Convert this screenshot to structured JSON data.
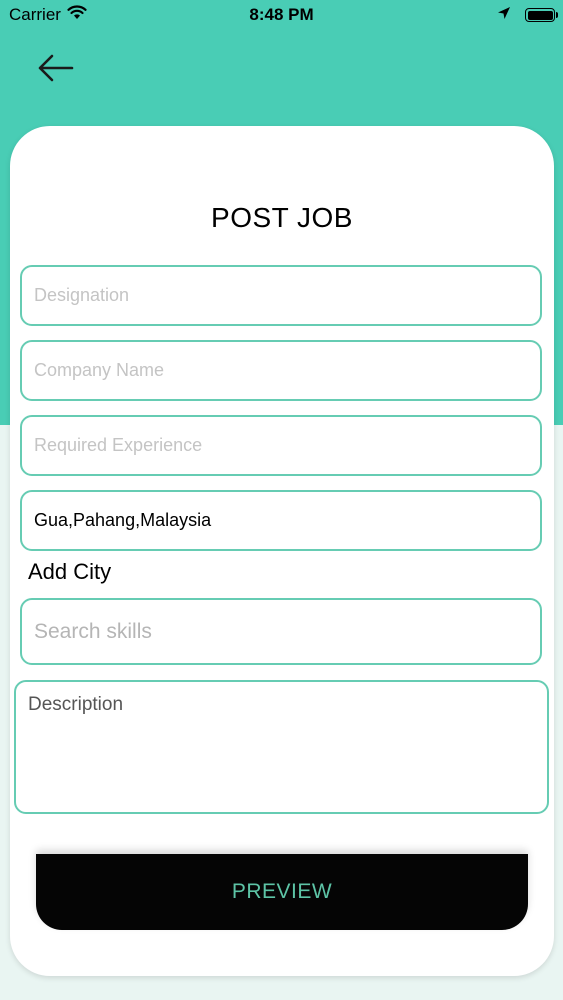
{
  "status_bar": {
    "carrier": "Carrier",
    "time": "8:48 PM"
  },
  "icons": {
    "back": "back-arrow-icon",
    "wifi": "wifi-icon",
    "location": "location-arrow-icon",
    "battery": "battery-icon"
  },
  "colors": {
    "header_teal": "#49cdb5",
    "field_border": "#66ccb3",
    "button_bg": "#050505",
    "button_text": "#5dc4a6"
  },
  "form": {
    "title": "POST JOB",
    "designation": {
      "placeholder": "Designation",
      "value": ""
    },
    "company_name": {
      "placeholder": "Company Name",
      "value": ""
    },
    "required_experience": {
      "placeholder": "Required Experience",
      "value": ""
    },
    "location": {
      "value": "Gua,Pahang,Malaysia"
    },
    "add_city_label": "Add City",
    "skills_search": {
      "placeholder": "Search skills",
      "value": ""
    },
    "description": {
      "placeholder": "Description",
      "value": ""
    },
    "preview_label": "PREVIEW"
  }
}
